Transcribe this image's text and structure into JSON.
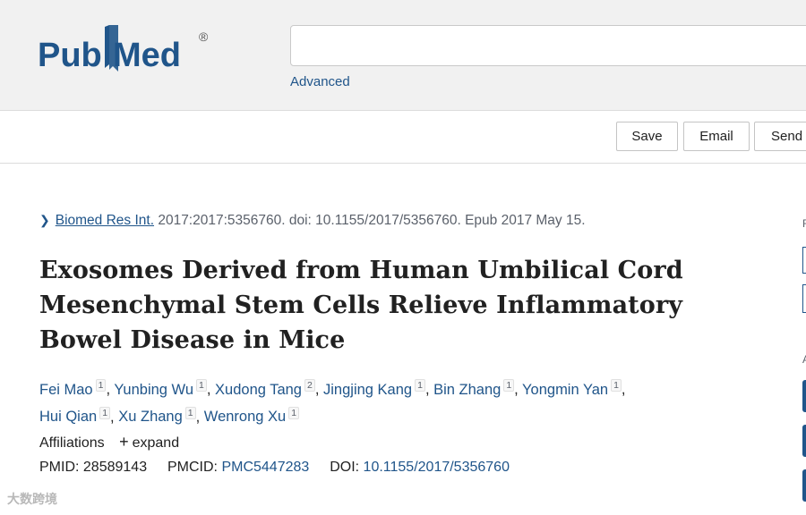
{
  "header": {
    "logo_text_pub": "Pub",
    "logo_text_med": "Med",
    "logo_registered": "®",
    "search_value": "",
    "advanced_label": "Advanced"
  },
  "actions": {
    "save_label": "Save",
    "email_label": "Email",
    "send_label": "Send t"
  },
  "citation": {
    "journal": "Biomed Res Int.",
    "details": "2017:2017:5356760. doi: 10.1155/2017/5356760. Epub 2017 May 15."
  },
  "article": {
    "title": "Exosomes Derived from Human Umbilical Cord Mesenchymal Stem Cells Relieve Inflammatory Bowel Disease in Mice",
    "authors": [
      {
        "name": "Fei Mao",
        "aff": "1"
      },
      {
        "name": "Yunbing Wu",
        "aff": "1"
      },
      {
        "name": "Xudong Tang",
        "aff": "2"
      },
      {
        "name": "Jingjing Kang",
        "aff": "1"
      },
      {
        "name": "Bin Zhang",
        "aff": "1"
      },
      {
        "name": "Yongmin Yan",
        "aff": "1"
      },
      {
        "name": "Hui Qian",
        "aff": "1"
      },
      {
        "name": "Xu Zhang",
        "aff": "1"
      },
      {
        "name": "Wenrong Xu",
        "aff": "1"
      }
    ],
    "affiliations_label": "Affiliations",
    "expand_label": "expand",
    "pmid_label": "PMID:",
    "pmid": "28589143",
    "pmcid_label": "PMCID:",
    "pmcid": "PMC5447283",
    "doi_label": "DOI:",
    "doi": "10.1155/2017/5356760"
  },
  "right_column": {
    "label_top": "F",
    "label_mid": "A"
  },
  "watermark": "大数跨境",
  "colors": {
    "link": "#20558a",
    "logo_blue": "#20558a",
    "header_bg": "#f1f1f1"
  }
}
